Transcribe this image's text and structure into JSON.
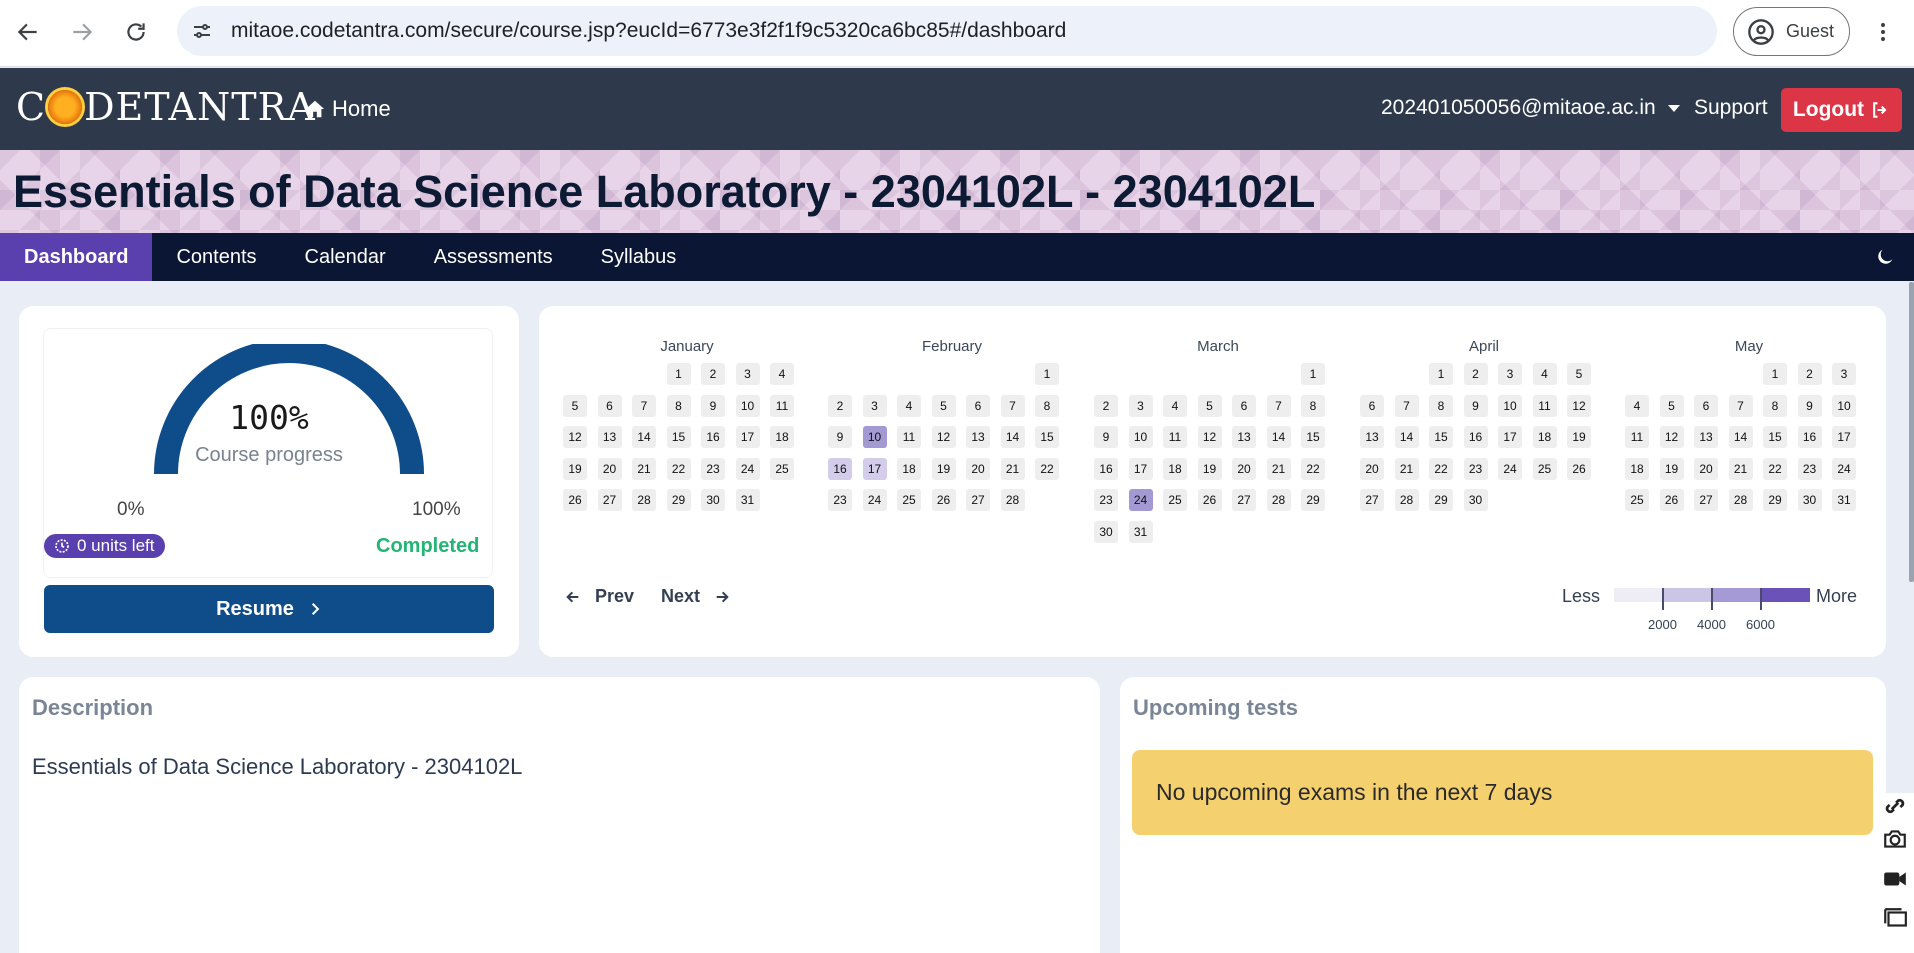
{
  "browser": {
    "url": "mitaoe.codetantra.com/secure/course.jsp?eucId=6773e3f2f1f9c5320ca6bc85#/dashboard",
    "profile_label": "Guest",
    "icons": [
      "back-arrow-icon",
      "forward-arrow-icon",
      "reload-icon",
      "site-info-icon",
      "profile-icon",
      "kebab-menu-icon"
    ]
  },
  "header": {
    "logo_before": "C",
    "logo_after": "DETANTRA",
    "home_label": "Home",
    "user_email": "202401050056@mitaoe.ac.in",
    "support_label": "Support",
    "logout_label": "Logout"
  },
  "course": {
    "title": "Essentials of Data Science Laboratory - 2304102L - 2304102L"
  },
  "tabs": [
    {
      "label": "Dashboard",
      "active": true
    },
    {
      "label": "Contents",
      "active": false
    },
    {
      "label": "Calendar",
      "active": false
    },
    {
      "label": "Assessments",
      "active": false
    },
    {
      "label": "Syllabus",
      "active": false
    }
  ],
  "progress": {
    "value_text": "100%",
    "fraction": 1.0,
    "label": "Course progress",
    "min_label": "0%",
    "max_label": "100%",
    "units_left": "0 units left",
    "status": "Completed",
    "resume_label": "Resume"
  },
  "calendar": {
    "months": [
      {
        "name": "January",
        "offset": 3,
        "days": 31,
        "activity": {}
      },
      {
        "name": "February",
        "offset": 6,
        "days": 28,
        "activity": {
          "10": 2,
          "16": 1,
          "17": 1
        }
      },
      {
        "name": "March",
        "offset": 6,
        "days": 31,
        "activity": {
          "24": 2
        }
      },
      {
        "name": "April",
        "offset": 2,
        "days": 30,
        "activity": {}
      },
      {
        "name": "May",
        "offset": 4,
        "days": 31,
        "activity": {}
      }
    ],
    "prev_label": "Prev",
    "next_label": "Next",
    "legend": {
      "less_label": "Less",
      "more_label": "More",
      "ticks": [
        "2000",
        "4000",
        "6000"
      ],
      "colors": [
        "#eeedf6",
        "#cbc5e6",
        "#a599d6",
        "#6a52b8"
      ]
    }
  },
  "description": {
    "title": "Description",
    "text": "Essentials of Data Science Laboratory - 2304102L"
  },
  "upcoming": {
    "title": "Upcoming tests",
    "message": "No upcoming exams in the next 7 days"
  },
  "colors": {
    "header_bg": "#2e3a4b",
    "tabs_bg": "#0a1633",
    "tab_active": "#5a3fae",
    "resume": "#0f4c8a",
    "logout": "#dc3545",
    "completed": "#22b573",
    "alert": "#f5d06e"
  }
}
